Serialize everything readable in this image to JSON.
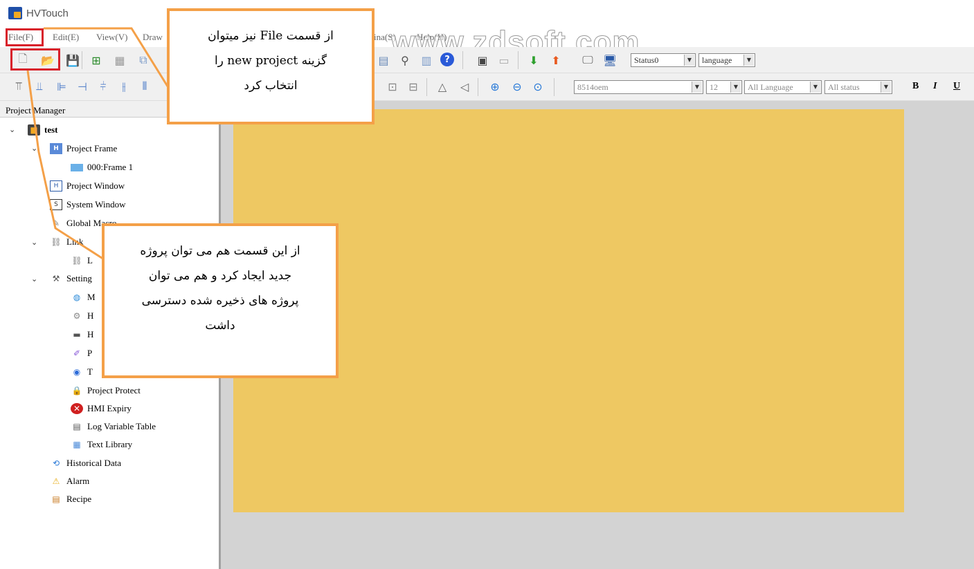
{
  "window": {
    "title": "HVTouch"
  },
  "menu": [
    "File(F)",
    "Edit(E)",
    "View(V)",
    "Draw",
    "ina(S)",
    "Help(H)"
  ],
  "watermark": "www.zdsoft.com",
  "toolbar": {
    "status_select": "Status0",
    "language_select": "language",
    "font_select": "8514oem",
    "font_size_select": "12",
    "language_filter_select": "All Language",
    "status_filter_select": "All status",
    "bold_label": "B",
    "italic_label": "I",
    "underline_label": "U"
  },
  "project_manager": {
    "title": "Project Manager",
    "tree": {
      "root": "test",
      "project_frame": "Project Frame",
      "frame1": "000:Frame 1",
      "project_window": "Project Window",
      "system_window": "System Window",
      "global_macro": "Global Macro",
      "link": "Link",
      "link_child": "L",
      "settings": "Setting",
      "settings_children": [
        "M",
        "H",
        "H",
        "P",
        "T"
      ],
      "project_protect": "Project Protect",
      "hmi_expiry": "HMI Expiry",
      "log_variable_table": "Log Variable Table",
      "text_library": "Text Library",
      "historical_data": "Historical Data",
      "alarm": "Alarm",
      "recipe": "Recipe"
    }
  },
  "annotations": {
    "top": [
      "از قسمت File نیز میتوان",
      "گزینه  new project را",
      "انتخاب کرد"
    ],
    "middle": [
      "از این قسمت هم می توان پروژه",
      "جدید ایجاد کرد و هم می توان",
      "پروژه های ذخیره شده دسترسی",
      "داشت"
    ]
  },
  "colors": {
    "canvas": "#eec862",
    "workspace": "#d3d3d3",
    "callout_border": "#f4a048",
    "highlight": "#d8202a"
  }
}
